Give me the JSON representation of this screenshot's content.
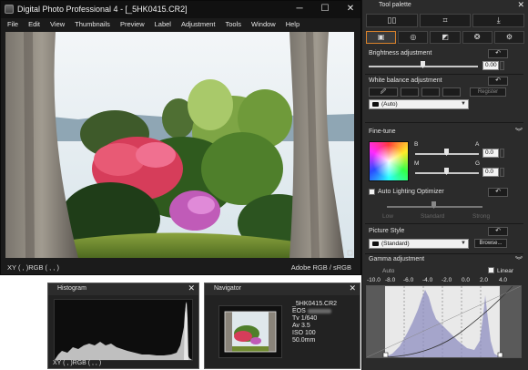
{
  "main_window": {
    "title": "Digital Photo Professional 4 - [_5HK0415.CR2]",
    "controls": {
      "minimize": "─",
      "maximize": "☐",
      "close": "✕"
    },
    "menu": [
      "File",
      "Edit",
      "View",
      "Thumbnails",
      "Preview",
      "Label",
      "Adjustment",
      "Tools",
      "Window",
      "Help"
    ],
    "status_left": "XY (    ,    )RGB (    ,    ,    )",
    "status_right": "Adobe RGB / sRGB"
  },
  "histogram": {
    "title": "Histogram",
    "close": "✕",
    "readout": "XY (    ,    )RGB (    ,    ,    )"
  },
  "navigator": {
    "title": "Navigator",
    "close": "✕",
    "filename": "_5HK0415.CR2",
    "camera_prefix": "EOS",
    "shutter": "Tv 1/640",
    "aperture": "Av 3.5",
    "iso": "ISO 100",
    "focal_length": "50.0mm"
  },
  "tool_palette": {
    "title": "Tool palette",
    "close": "✕",
    "brightness": {
      "label": "Brightness adjustment",
      "value": "0.00"
    },
    "white_balance": {
      "label": "White balance adjustment",
      "register": "Register",
      "mode": "(Auto)"
    },
    "fine_tune": {
      "label": "Fine-tune",
      "b": "B",
      "a": "A",
      "m": "M",
      "g": "G",
      "a_value": "0.0",
      "g_value": "0.0"
    },
    "alo": {
      "label": "Auto Lighting Optimizer",
      "low": "Low",
      "standard": "Standard",
      "strong": "Strong"
    },
    "picture_style": {
      "label": "Picture Style",
      "value": "(Standard)",
      "browse": "Browse..."
    },
    "gamma": {
      "label": "Gamma adjustment",
      "auto": "Auto",
      "linear": "Linear",
      "scale": [
        "-10.0",
        "-8.0",
        "-6.0",
        "-4.0",
        "-2.0",
        "0.0",
        "2.0",
        "4.0"
      ]
    }
  }
}
